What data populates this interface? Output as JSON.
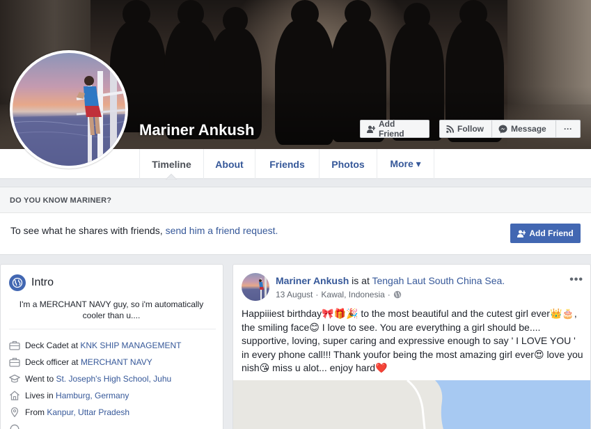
{
  "profile": {
    "name": "Mariner Ankush"
  },
  "cover_buttons": {
    "add_friend": "Add Friend",
    "follow": "Follow",
    "message": "Message",
    "more": "···"
  },
  "tabs": [
    {
      "label": "Timeline"
    },
    {
      "label": "About"
    },
    {
      "label": "Friends"
    },
    {
      "label": "Photos"
    },
    {
      "label": "More ▾"
    }
  ],
  "know": {
    "heading": "DO YOU KNOW MARINER?",
    "text": "To see what he shares with friends, ",
    "link": "send him a friend request.",
    "button": "Add Friend"
  },
  "intro": {
    "title": "Intro",
    "bio": "I'm a MERCHANT NAVY guy, so i'm automatically cooler than u....",
    "rows": [
      {
        "icon": "briefcase-icon",
        "prefix": "Deck Cadet at ",
        "link": "KNK SHIP MANAGEMENT"
      },
      {
        "icon": "briefcase-icon",
        "prefix": "Deck officer at ",
        "link": "MERCHANT NAVY"
      },
      {
        "icon": "graduation-cap-icon",
        "prefix": "Went to ",
        "link": "St. Joseph's High School, Juhu"
      },
      {
        "icon": "home-icon",
        "prefix": "Lives in ",
        "link": "Hamburg, Germany"
      },
      {
        "icon": "location-pin-icon",
        "prefix": "From ",
        "link": "Kanpur, Uttar Pradesh"
      }
    ]
  },
  "post": {
    "author": "Mariner Ankush",
    "is_at": " is at ",
    "place": "Tengah Laut South China Sea.",
    "date": "13 August",
    "location": "Kawal, Indonesia",
    "separator": "·",
    "menu": "•••",
    "body": "Happiiiest birthday🎀🎁🎉 to the most beautiful and the cutest girl ever👑🎂, the smiling face😊 I love to see. You are everything a girl should be.... supportive, loving, super caring and expressive enough to say ' I LOVE YOU ' in every phone call!!! Thank youfor being the most amazing girl ever😍 love you nish😘 miss u alot... enjoy hard❤️"
  },
  "colors": {
    "brand_blue": "#4267b2",
    "link_blue": "#365899",
    "page_bg": "#e9ebee"
  }
}
